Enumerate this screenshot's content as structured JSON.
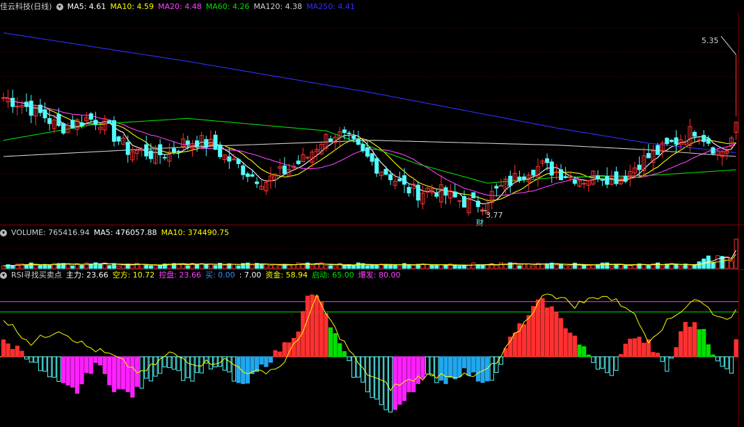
{
  "colors": {
    "up": "#ff3030",
    "down": "#54fcfc",
    "ma5": "#ffffff",
    "ma10": "#ffff00",
    "ma20": "#ff40ff",
    "ma60": "#00e000",
    "ma120": "#d0d0d0",
    "ma250": "#3030ff",
    "grid": "#800000"
  },
  "price_header": {
    "title": "佳云科技(日线)",
    "items": [
      {
        "label": "MA5: 4.61",
        "color": "#ffffff"
      },
      {
        "label": "MA10: 4.59",
        "color": "#ffff00"
      },
      {
        "label": "MA20: 4.48",
        "color": "#ff40ff"
      },
      {
        "label": "MA60: 4.26",
        "color": "#00e000"
      },
      {
        "label": "MA120: 4.38",
        "color": "#d0d0d0"
      },
      {
        "label": "MA250: 4.41",
        "color": "#3030ff"
      }
    ]
  },
  "volume_header": {
    "items": [
      {
        "label": "VOLUME: 765416.94",
        "color": "#d0d0d0"
      },
      {
        "label": "MA5: 476057.88",
        "color": "#ffffff"
      },
      {
        "label": "MA10: 374490.75",
        "color": "#ffff00"
      }
    ]
  },
  "rsi_header": {
    "title": "RSI寻找买卖点",
    "items": [
      {
        "label": "主力: 23.66",
        "color": "#ffffff"
      },
      {
        "label": "空方: 10.72",
        "color": "#ffff00"
      },
      {
        "label": "控盘: 23.66",
        "color": "#ff40ff"
      },
      {
        "label": "买: 0.00",
        "color": "#3090ff"
      },
      {
        "label": ": 7.00",
        "color": "#ffffff"
      },
      {
        "label": "资金: 58.94",
        "color": "#ffff00"
      },
      {
        "label": "启动: 65.00",
        "color": "#00e000"
      },
      {
        "label": "爆发: 80.00",
        "color": "#ff40ff"
      }
    ]
  },
  "annotations": {
    "high_label": "5.35",
    "low_label": "3.77",
    "event_tag": "财"
  },
  "chart_data": [
    {
      "type": "candlestick",
      "title": "佳云科技(日线)",
      "ylim": [
        3.6,
        5.75
      ],
      "high": {
        "value": 5.35,
        "label": "5.35"
      },
      "low": {
        "value": 3.77,
        "label": "3.77"
      },
      "close_path": [
        [
          0,
          4.9
        ],
        [
          3,
          4.85
        ],
        [
          6,
          4.78
        ],
        [
          9,
          4.7
        ],
        [
          12,
          4.58
        ],
        [
          15,
          4.62
        ],
        [
          18,
          4.68
        ],
        [
          21,
          4.66
        ],
        [
          24,
          4.5
        ],
        [
          27,
          4.35
        ],
        [
          30,
          4.33
        ],
        [
          33,
          4.3
        ],
        [
          36,
          4.32
        ],
        [
          39,
          4.42
        ],
        [
          42,
          4.45
        ],
        [
          45,
          4.4
        ],
        [
          48,
          4.28
        ],
        [
          51,
          4.18
        ],
        [
          54,
          4.08
        ],
        [
          57,
          4.02
        ],
        [
          60,
          4.1
        ],
        [
          63,
          4.18
        ],
        [
          66,
          4.28
        ],
        [
          69,
          4.45
        ],
        [
          72,
          4.52
        ],
        [
          75,
          4.45
        ],
        [
          78,
          4.3
        ],
        [
          81,
          4.18
        ],
        [
          84,
          4.08
        ],
        [
          87,
          3.95
        ],
        [
          90,
          3.9
        ],
        [
          93,
          3.95
        ],
        [
          96,
          3.88
        ],
        [
          99,
          3.82
        ],
        [
          102,
          3.78
        ],
        [
          104,
          3.8
        ],
        [
          106,
          3.88
        ],
        [
          108,
          3.95
        ],
        [
          111,
          4.05
        ],
        [
          114,
          4.15
        ],
        [
          117,
          4.18
        ],
        [
          120,
          4.12
        ],
        [
          123,
          4.08
        ],
        [
          126,
          4.04
        ],
        [
          129,
          4.1
        ],
        [
          132,
          4.05
        ],
        [
          135,
          4.08
        ],
        [
          138,
          4.22
        ],
        [
          141,
          4.3
        ],
        [
          144,
          4.38
        ],
        [
          147,
          4.48
        ],
        [
          150,
          4.56
        ],
        [
          153,
          4.45
        ],
        [
          155,
          4.32
        ],
        [
          157,
          4.36
        ],
        [
          159,
          4.58
        ]
      ],
      "ma_path_ma250": [
        [
          0,
          5.58
        ],
        [
          40,
          5.28
        ],
        [
          80,
          4.95
        ],
        [
          120,
          4.58
        ],
        [
          140,
          4.42
        ],
        [
          159,
          4.32
        ]
      ],
      "ma_path_ma120": [
        [
          0,
          4.28
        ],
        [
          40,
          4.38
        ],
        [
          80,
          4.45
        ],
        [
          120,
          4.4
        ],
        [
          140,
          4.35
        ],
        [
          159,
          4.28
        ]
      ],
      "ma_path_ma60": [
        [
          0,
          4.45
        ],
        [
          20,
          4.62
        ],
        [
          40,
          4.68
        ],
        [
          70,
          4.55
        ],
        [
          90,
          4.2
        ],
        [
          105,
          4.0
        ],
        [
          120,
          4.06
        ],
        [
          140,
          4.08
        ],
        [
          159,
          4.14
        ]
      ]
    },
    {
      "type": "bar",
      "title": "VOLUME",
      "ylim": [
        0,
        800000
      ],
      "latest": 765416.94,
      "ma5": 476057.88,
      "ma10": 374490.75
    },
    {
      "type": "bar",
      "title": "RSI寻找买卖点",
      "ylim": [
        -100,
        110
      ],
      "reference_lines": [
        {
          "name": "启动",
          "value": 65.0
        },
        {
          "name": "爆发",
          "value": 80.0
        }
      ],
      "bar_path": [
        [
          0,
          20
        ],
        [
          4,
          10
        ],
        [
          8,
          -20
        ],
        [
          12,
          -40
        ],
        [
          16,
          -50
        ],
        [
          20,
          -8
        ],
        [
          24,
          -45
        ],
        [
          28,
          -55
        ],
        [
          32,
          -30
        ],
        [
          36,
          -10
        ],
        [
          40,
          -35
        ],
        [
          44,
          -15
        ],
        [
          48,
          -20
        ],
        [
          52,
          -45
        ],
        [
          56,
          -15
        ],
        [
          60,
          10
        ],
        [
          64,
          40
        ],
        [
          66,
          85
        ],
        [
          68,
          90
        ],
        [
          70,
          60
        ],
        [
          72,
          30
        ],
        [
          76,
          -25
        ],
        [
          80,
          -55
        ],
        [
          84,
          -85
        ],
        [
          88,
          -50
        ],
        [
          92,
          -30
        ],
        [
          96,
          -35
        ],
        [
          100,
          -20
        ],
        [
          104,
          -35
        ],
        [
          107,
          -25
        ],
        [
          110,
          25
        ],
        [
          114,
          60
        ],
        [
          117,
          85
        ],
        [
          120,
          60
        ],
        [
          124,
          30
        ],
        [
          128,
          -10
        ],
        [
          132,
          -30
        ],
        [
          136,
          30
        ],
        [
          140,
          20
        ],
        [
          144,
          -20
        ],
        [
          148,
          50
        ],
        [
          152,
          40
        ],
        [
          155,
          -10
        ],
        [
          158,
          -25
        ],
        [
          159,
          30
        ]
      ],
      "line_path": [
        [
          0,
          55
        ],
        [
          6,
          20
        ],
        [
          12,
          40
        ],
        [
          18,
          15
        ],
        [
          24,
          0
        ],
        [
          30,
          -25
        ],
        [
          36,
          5
        ],
        [
          42,
          -10
        ],
        [
          48,
          -5
        ],
        [
          54,
          -25
        ],
        [
          60,
          -15
        ],
        [
          64,
          25
        ],
        [
          68,
          85
        ],
        [
          72,
          40
        ],
        [
          78,
          -20
        ],
        [
          84,
          -45
        ],
        [
          90,
          -30
        ],
        [
          96,
          -25
        ],
        [
          102,
          -30
        ],
        [
          107,
          -10
        ],
        [
          112,
          40
        ],
        [
          118,
          95
        ],
        [
          124,
          75
        ],
        [
          130,
          90
        ],
        [
          136,
          70
        ],
        [
          140,
          25
        ],
        [
          144,
          50
        ],
        [
          150,
          85
        ],
        [
          156,
          55
        ],
        [
          159,
          65
        ]
      ]
    }
  ]
}
